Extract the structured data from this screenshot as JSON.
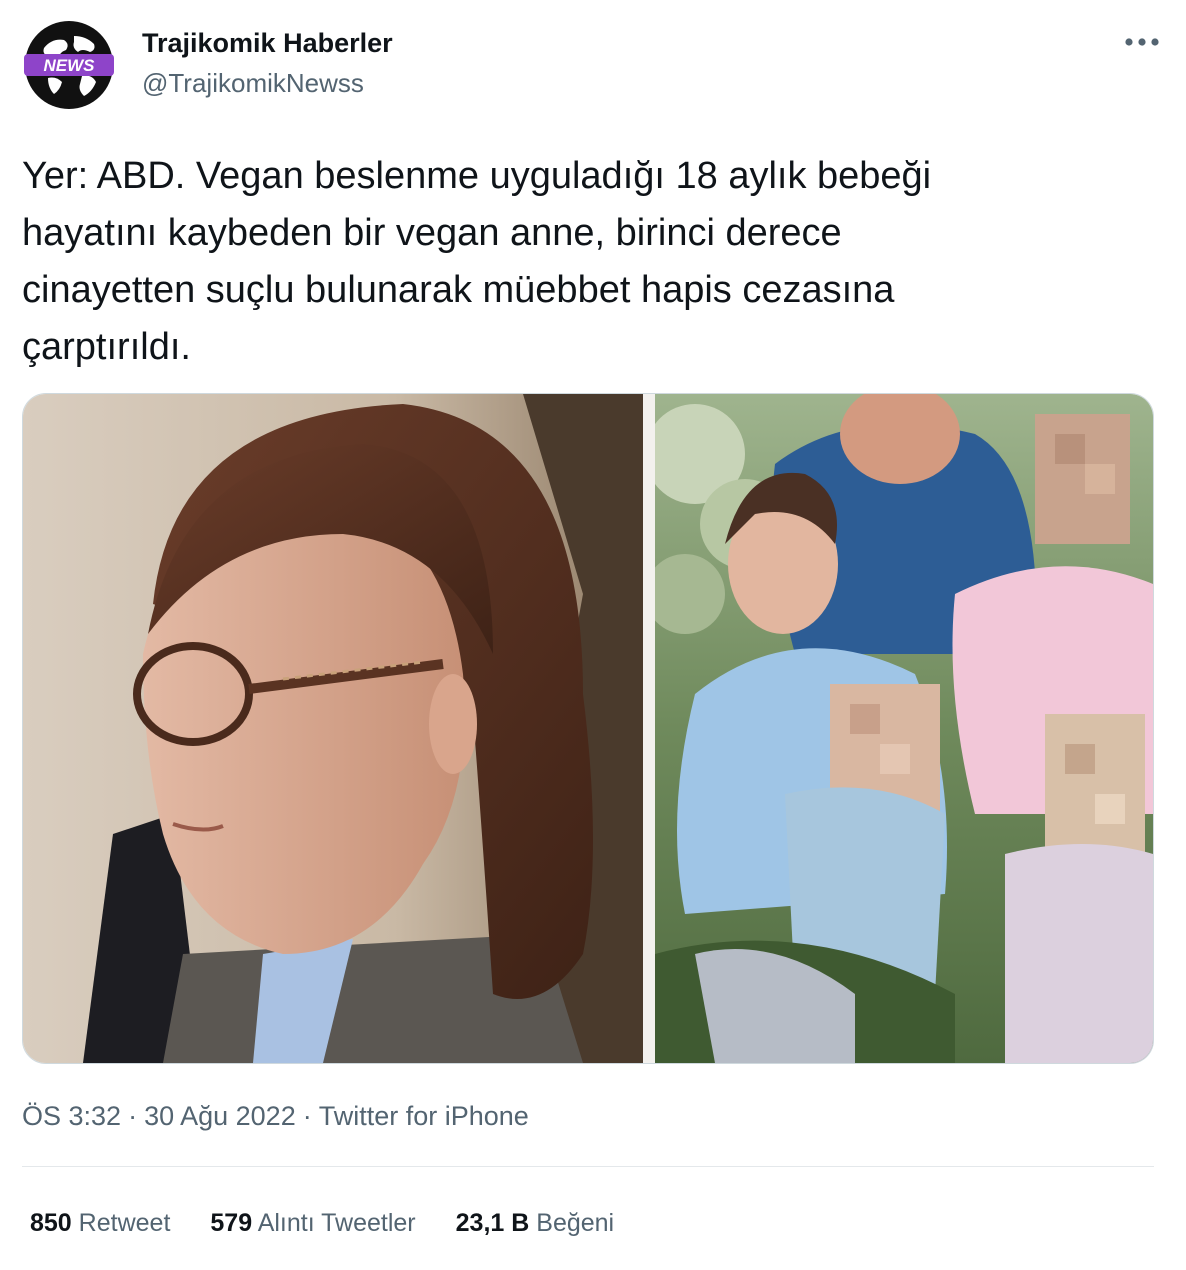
{
  "author": {
    "display_name": "Trajikomik Haberler",
    "handle": "@TrajikomikNewss",
    "avatar_badge": "NEWS",
    "avatar_icon": "globe-icon"
  },
  "more_icon": "more-horizontal-icon",
  "tweet": {
    "text": "Yer: ABD. Vegan beslenme uyguladığı 18 aylık bebeği\nhayatını kaybeden bir vegan anne, birinci derece\ncinayetten suçlu bulunarak müebbet hapis cezasına\nçarptırıldı."
  },
  "media": {
    "count": 2
  },
  "meta": {
    "time": "ÖS 3:32",
    "separator": "·",
    "date": "30 Ağu 2022",
    "source": "Twitter for iPhone"
  },
  "stats": {
    "retweets_count": "850",
    "retweets_label": "Retweet",
    "quotes_count": "579",
    "quotes_label": "Alıntı Tweetler",
    "likes_count": "23,1 B",
    "likes_label": "Beğeni"
  },
  "colors": {
    "text_primary": "#0f1419",
    "text_secondary": "#536471",
    "border": "#cfd9de",
    "badge_purple": "#8e44c9"
  }
}
